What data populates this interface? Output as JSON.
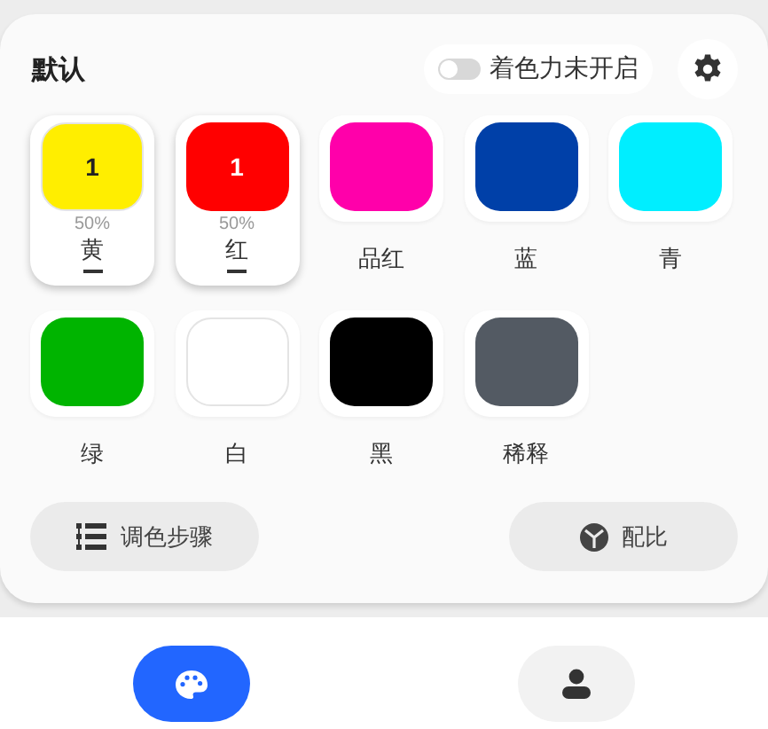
{
  "header": {
    "title": "默认",
    "toggle": {
      "label": "着色力未开启",
      "on": false
    }
  },
  "swatches": [
    {
      "name": "黄",
      "color": "#ffee00",
      "selected": true,
      "count": "1",
      "percent": "50%"
    },
    {
      "name": "红",
      "color": "#ff0000",
      "selected": true,
      "count": "1",
      "percent": "50%"
    },
    {
      "name": "品红",
      "color": "#ff00aa",
      "selected": false
    },
    {
      "name": "蓝",
      "color": "#0040a8",
      "selected": false
    },
    {
      "name": "青",
      "color": "#00eeff",
      "selected": false
    },
    {
      "name": "绿",
      "color": "#00b400",
      "selected": false
    },
    {
      "name": "白",
      "color": "#ffffff",
      "selected": false
    },
    {
      "name": "黑",
      "color": "#000000",
      "selected": false
    },
    {
      "name": "稀释",
      "color": "#535a63",
      "selected": false
    }
  ],
  "actions": [
    {
      "label": "调色步骤",
      "kind": "steps"
    },
    {
      "label": "配比",
      "kind": "ratio"
    }
  ],
  "nav": [
    {
      "kind": "palette",
      "selected": true
    },
    {
      "kind": "person",
      "selected": false
    }
  ]
}
